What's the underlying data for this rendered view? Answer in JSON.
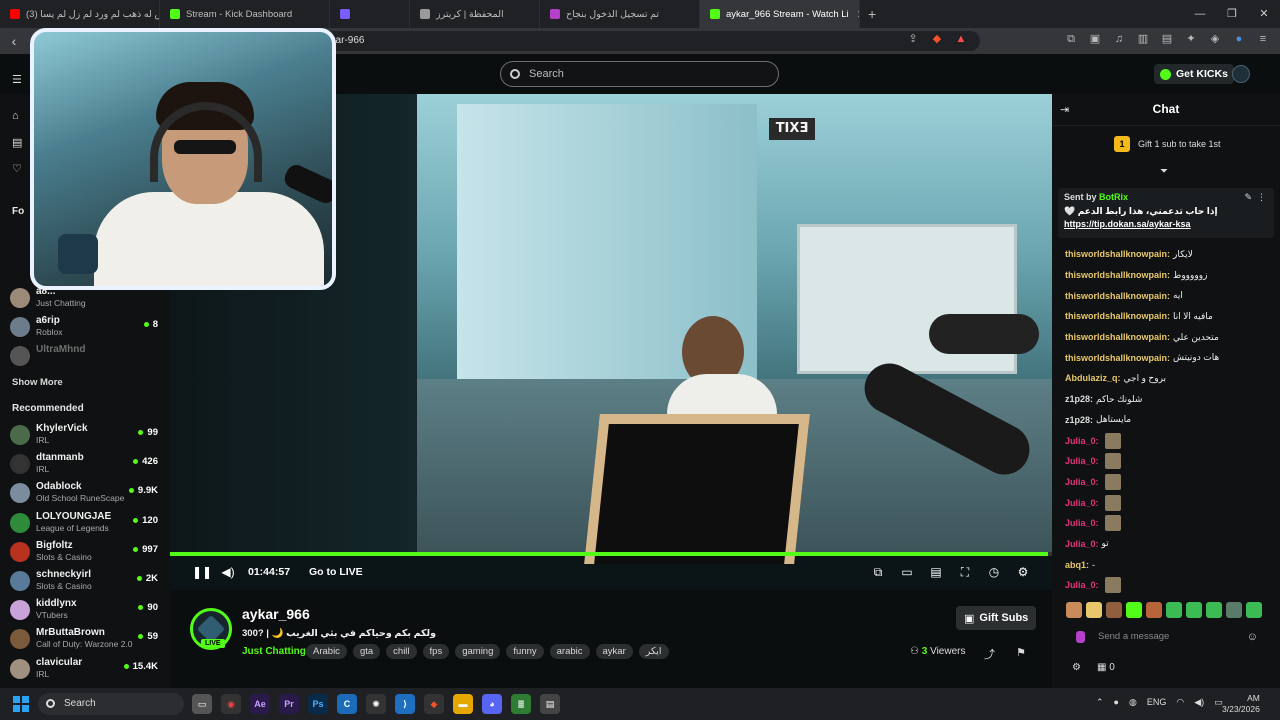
{
  "browser": {
    "tabs": [
      {
        "label": "(3) إقرش له ذهب لم ورد لم زل لم يسا",
        "color": "#ff0000"
      },
      {
        "label": "Stream - Kick Dashboard",
        "color": "#53fc18"
      },
      {
        "label": "",
        "color": "#7b5cff"
      },
      {
        "label": "المحفظة | كريترز",
        "color": "#9a9a9a"
      },
      {
        "label": "تم تسجيل الدخول بنجاح",
        "color": "#b640c9"
      },
      {
        "label": "aykar_966 Stream - Watch Li",
        "color": "#53fc18",
        "active": true
      }
    ],
    "new_tab": "+",
    "url": "aykar-966"
  },
  "kick": {
    "search_placeholder": "Search",
    "get_kicks": "Get KICKs"
  },
  "sidebar": {
    "following_label": "Fo",
    "following": [
      {
        "name": "a8...",
        "category": "Just Chatting",
        "count": "",
        "color": "#9c8a78"
      },
      {
        "name": "a6rip",
        "category": "Roblox",
        "count": "8",
        "color": "#6c7c8a"
      },
      {
        "name": "UltraMhnd",
        "category": "",
        "count": "",
        "color": "#555555"
      }
    ],
    "show_more": "Show More",
    "recommended_label": "Recommended",
    "recommended": [
      {
        "name": "KhylerVick",
        "category": "IRL",
        "count": "99",
        "color": "#4a6a4a"
      },
      {
        "name": "dtanmanb",
        "category": "IRL",
        "count": "426",
        "color": "#333333"
      },
      {
        "name": "Odablock",
        "category": "Old School RuneScape",
        "count": "9.9K",
        "color": "#7a8c9e"
      },
      {
        "name": "LOLYOUNGJAE",
        "category": "League of Legends",
        "count": "120",
        "color": "#2e8b3a"
      },
      {
        "name": "Bigfoltz",
        "category": "Slots & Casino",
        "count": "997",
        "color": "#b8321f"
      },
      {
        "name": "schneckyirl",
        "category": "Slots & Casino",
        "count": "2K",
        "color": "#5a7a9a"
      },
      {
        "name": "kiddlynx",
        "category": "VTubers",
        "count": "90",
        "color": "#c9a2d9"
      },
      {
        "name": "MrButtaBrown",
        "category": "Call of Duty: Warzone 2.0",
        "count": "59",
        "color": "#7a5a3a"
      },
      {
        "name": "clavicular",
        "category": "IRL",
        "count": "15.4K",
        "color": "#a09080"
      }
    ]
  },
  "player": {
    "time": "01:44:57",
    "go_live": "Go to LIVE",
    "progress": 0.995
  },
  "stream": {
    "streamer": "aykar_966",
    "live_badge": "LIVE",
    "title": "300? | 🌙 ولكم بكم وحياكم في بثي الغريب",
    "category": "Just Chatting",
    "tags": [
      "Arabic",
      "gta",
      "chill",
      "fps",
      "gaming",
      "funny",
      "arabic",
      "aykar",
      "ايكر"
    ],
    "gift_subs": "Gift Subs",
    "viewers_count": "3",
    "viewers_label": "Viewers"
  },
  "chat": {
    "title": "Chat",
    "gift_goal_num": "1",
    "gift_goal_text": "Gift 1 sub to take 1st",
    "pinned_sent_by": "Sent by",
    "pinned_bot": "BotRix",
    "pinned_msg": "🤍 إذا حاب تدعمني، هذا رابط الدعم",
    "pinned_link": "https://tip.dokan.sa/aykar-ksa",
    "messages": [
      {
        "user": "thisworldshallknowpain:",
        "text": "لايكار",
        "color": "#e8c86a",
        "emote": false
      },
      {
        "user": "thisworldshallknowpain:",
        "text": "زوووووط",
        "color": "#e8c86a",
        "emote": false
      },
      {
        "user": "thisworldshallknowpain:",
        "text": "ايه",
        "color": "#e8c86a",
        "emote": false
      },
      {
        "user": "thisworldshallknowpain:",
        "text": "مافيه الا انا",
        "color": "#e8c86a",
        "emote": false
      },
      {
        "user": "thisworldshallknowpain:",
        "text": "متحدين علي",
        "color": "#e8c86a",
        "emote": false
      },
      {
        "user": "thisworldshallknowpain:",
        "text": "هات دونيتش",
        "color": "#e8c86a",
        "emote": false
      },
      {
        "user": "Abdulaziz_q:",
        "text": "بروح و اجي",
        "color": "#e8c86a",
        "emote": false
      },
      {
        "user": "z1p28:",
        "text": "شلونك حاكم",
        "color": "#dddddd",
        "emote": false
      },
      {
        "user": "z1p28:",
        "text": "مايستاهل",
        "color": "#dddddd",
        "emote": false
      },
      {
        "user": "Julia_0:",
        "text": "",
        "color": "#e0357a",
        "emote": true
      },
      {
        "user": "Julia_0:",
        "text": "",
        "color": "#e0357a",
        "emote": true
      },
      {
        "user": "Julia_0:",
        "text": "",
        "color": "#e0357a",
        "emote": true
      },
      {
        "user": "Julia_0:",
        "text": "",
        "color": "#e0357a",
        "emote": true
      },
      {
        "user": "Julia_0:",
        "text": "",
        "color": "#e0357a",
        "emote": true
      },
      {
        "user": "Julia_0:",
        "text": "تو",
        "color": "#e0357a",
        "emote": false
      },
      {
        "user": "abq1:",
        "text": "-",
        "color": "#e8c86a",
        "emote": false
      },
      {
        "user": "Julia_0:",
        "text": "",
        "color": "#e0357a",
        "emote": true
      }
    ],
    "send_placeholder": "Send a message",
    "bottom_count": "0"
  },
  "taskbar": {
    "search": "Search",
    "lang": "ENG",
    "time": "AM",
    "date": "3/23/2026"
  },
  "colors": {
    "accent": "#53fc18",
    "bg": "#0b0e0f",
    "panel": "#0f1112"
  }
}
